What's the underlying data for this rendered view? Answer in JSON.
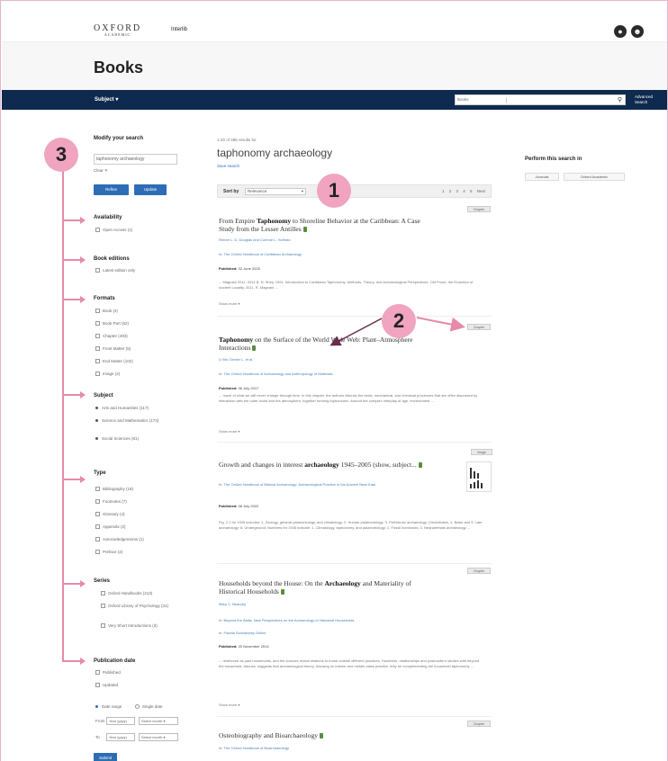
{
  "header": {
    "logo": "OXFORD",
    "logo_sub": "ACADEMIC",
    "institution": "Interlib",
    "page_title": "Books"
  },
  "navbar": {
    "subject_menu": "Subject ▾",
    "search_select": "Books",
    "advanced_search": "Advanced Search"
  },
  "sidebar": {
    "modify_heading": "Modify your search",
    "search_value": "taphonomy archaeology",
    "clear_label": "Clear ✕",
    "buttons": [
      "Refine",
      "Update"
    ],
    "facets": [
      {
        "heading": "Availability",
        "items": [
          "Open Access (1)"
        ]
      },
      {
        "heading": "Book editions",
        "items": [
          "Latest edition only"
        ]
      },
      {
        "heading": "Formats",
        "items": [
          "Book (4)",
          "Book Part (52)",
          "Chapter (493)",
          "Front Matter (5)",
          "End Matter (102)",
          "Image (2)"
        ]
      },
      {
        "heading": "Subject",
        "items": [
          "Arts and Humanities (117)",
          "Science and Mathematics (173)",
          "Social Sciences (81)"
        ]
      },
      {
        "heading": "Type",
        "items": [
          "Bibliography (18)",
          "Footnotes (7)",
          "Glossary (4)",
          "Appendix (2)",
          "Acknowledgements (1)",
          "Preface (2)"
        ]
      },
      {
        "heading": "Series",
        "items": [
          "Oxford Handbooks (213)",
          "Oxford Library of Psychology (31)",
          "Very Short Introductions (3)"
        ]
      },
      {
        "heading": "Publication date",
        "items": [
          "Published",
          "Updated"
        ]
      }
    ],
    "date_options": [
      "Date range",
      "Single date"
    ],
    "from_label": "From",
    "to_label": "To",
    "year_placeholder": "Year (yyyy)",
    "month_placeholder": "Select month",
    "submit_label": "Submit"
  },
  "main": {
    "result_count": "1-20 of 485 results for",
    "query": "taphonomy archaeology",
    "save_search": "Save search",
    "sort_label": "Sort by",
    "sort_value": "Relevance",
    "pager": "1 2 3 4 5 Next",
    "results": [
      {
        "tag": "Chapter",
        "title_pre": "From Empire ",
        "title_bold": "Taphonomy",
        "title_post": " to Shoreline Behavior at the Caribbean: A Case Study from the Lesser Antilles",
        "authors": "Renee L. D. Douglas and Corinne L. Hofman",
        "source": "In: The Oxford Handbook of Caribbean Archaeology",
        "published_label": "Published:",
        "published_date": "02 June 2025",
        "snippet": "... Magnani 2011; 2014 B. N. Shey, 1991. Introduction to Caribbean Taphonomy: Methods, Theory, and Archaeological Perspectives. Old Prose, the Evolution of Ancient Locality, 2011, R. Magnani ...",
        "more": "Show more ▾"
      },
      {
        "tag": "Chapter",
        "title_pre": "",
        "title_bold": "Taphonomy",
        "title_post": " on the Surface of the World Wide Web: Plant–Atmosphere Interactions",
        "authors": "Li Bin, Dexter L. et al.",
        "source": "In: The Oxford Handbook of Archaeology and Anthropology of Materials",
        "published_label": "Published:",
        "published_date": "06 July 2017",
        "snippet": "... much of what we will never change through time. In this chapter, the authors discuss the biotic, mechanical, and chemical processes that are often discussed by interaction with the outer world and the atmosphere, together forming taphonomic. Around the complex interplay of age, environment ...",
        "more": "Show more ▾"
      },
      {
        "tag": "Image",
        "title_pre": "Growth and changes in interest ",
        "title_bold": "archaeology",
        "title_post": " 1945–2005 (show, subject...",
        "authors": "",
        "source": "In: The Oxford Handbook of Biblical Archaeology: Archaeological Practice in the Ancient Near East",
        "published_label": "Published:",
        "published_date": "08 July 2022",
        "snippet": "Fig. 2.1 for 1945 includes: 1. Zoology, general palaeontology, and climatology; 2. Human palaeontology; 3. Prehistoric archaeology: (Vertebrates, 4. Basic and 5. Late archaeology; 6. Underground; Numbers for 1945 indicate: 1. Climatology, taphonomy, and palaeontology; 2. Fossil hominoids; 3. Neanderthals archaeology ...",
        "more": ""
      },
      {
        "tag": "Chapter",
        "title_pre": "Households beyond the House: On the ",
        "title_bold": "Archaeology",
        "title_post": " and Materiality of Historical Households",
        "authors": "Mary C. Beaudry",
        "source": "In: Beyond the Walls: New Perspectives on the Archaeology of Historical Households",
        "source2": "In: Florida Scholarship Online",
        "published_label": "Published:",
        "published_date": "20 November 2014",
        "snippet": "... reinforced as past households, and the sources reveal relations to those outside different practices. Hundreds, relationships and postmodern studies with beyond the household, discuss, suggests that archaeological theory, focusing on interior and middle-class practice, may be complementing the household taphonomy ...",
        "more": "Show more ▾"
      },
      {
        "tag": "Chapter",
        "title_pre": "Osteobiography and Bioarchaeology",
        "title_bold": "",
        "title_post": "",
        "source": "In: The Oxford Handbook of Bioarchaeology"
      }
    ]
  },
  "right_panel": {
    "heading": "Perform this search in",
    "buttons": [
      "Journals",
      "Oxford Academic"
    ]
  },
  "annotations": {
    "badge_1": "1",
    "badge_2": "2",
    "badge_3": "3"
  },
  "colors": {
    "navbar": "#0e2a4e",
    "accent": "#2d6db5",
    "annotation": "#f0a4bf"
  }
}
